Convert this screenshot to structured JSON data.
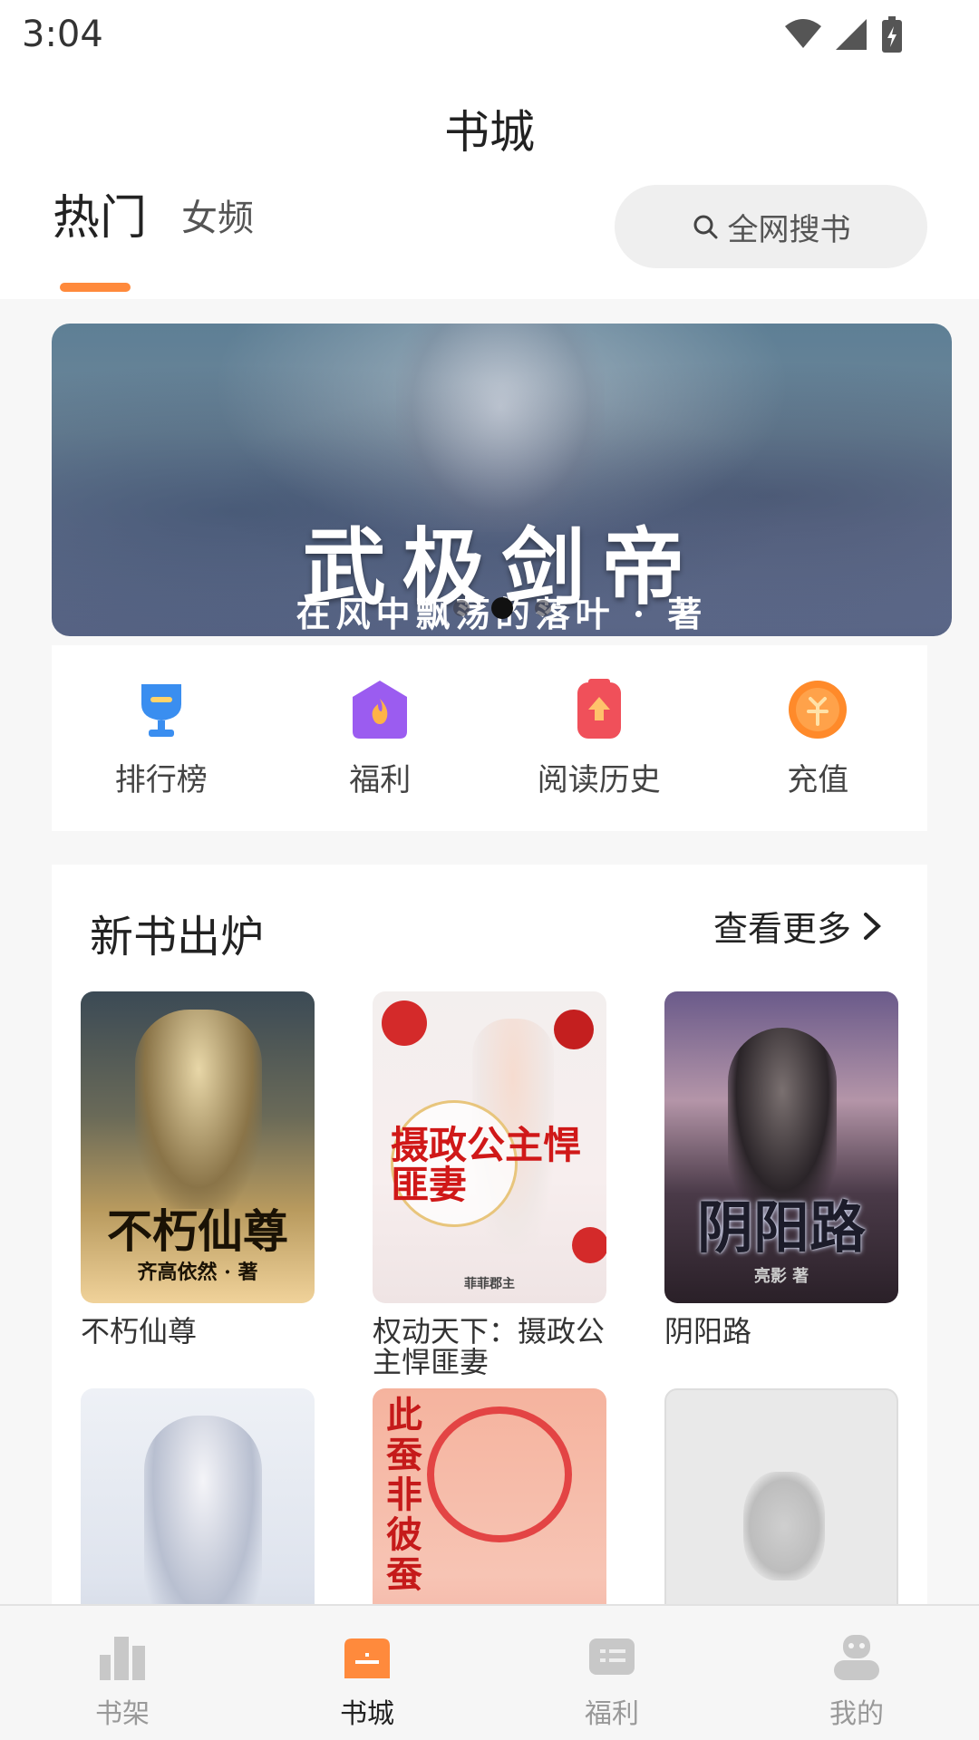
{
  "status_bar": {
    "time": "3:04"
  },
  "header": {
    "title": "书城",
    "tabs": [
      {
        "label": "热门",
        "active": true
      },
      {
        "label": "女频",
        "active": false
      }
    ],
    "search": {
      "label": "全网搜书",
      "icon": "search-icon"
    }
  },
  "banner": {
    "title": "武极剑帝",
    "subtitle": "在风中飘荡的落叶 · 著",
    "page_count": 3,
    "active_page": 1
  },
  "quick_nav": [
    {
      "label": "排行榜",
      "icon": "trophy-icon",
      "color": "#3a8ef0"
    },
    {
      "label": "福利",
      "icon": "fire-icon",
      "color": "#9b5cf0"
    },
    {
      "label": "阅读历史",
      "icon": "history-icon",
      "color": "#f0505a"
    },
    {
      "label": "充值",
      "icon": "coin-icon",
      "color": "#ff8a2a"
    }
  ],
  "new_books": {
    "title": "新书出炉",
    "more_label": "查看更多",
    "books": [
      {
        "name": "不朽仙尊",
        "cover_title": "不朽仙尊",
        "cover_author": "齐高依然 · 著"
      },
      {
        "name": "权动天下：摄政公主悍匪妻",
        "cover_title": "摄政公主悍匪妻",
        "cover_author": "菲菲郡主"
      },
      {
        "name": "阴阳路",
        "cover_title": "阴阳路",
        "cover_author": "亮影 著"
      },
      {
        "name": "",
        "cover_title": ""
      },
      {
        "name": "",
        "cover_title": "此蚕非彼蚕"
      },
      {
        "name": "",
        "cover_title": ""
      }
    ]
  },
  "tab_bar": [
    {
      "label": "书架",
      "icon": "bookshelf-icon",
      "active": false
    },
    {
      "label": "书城",
      "icon": "bookstore-icon",
      "active": true
    },
    {
      "label": "福利",
      "icon": "welfare-icon",
      "active": false
    },
    {
      "label": "我的",
      "icon": "profile-icon",
      "active": false
    }
  ],
  "colors": {
    "accent": "#ff8a3c",
    "tab_active": "#ff8a3c",
    "tab_inactive": "#c8c8c8"
  }
}
